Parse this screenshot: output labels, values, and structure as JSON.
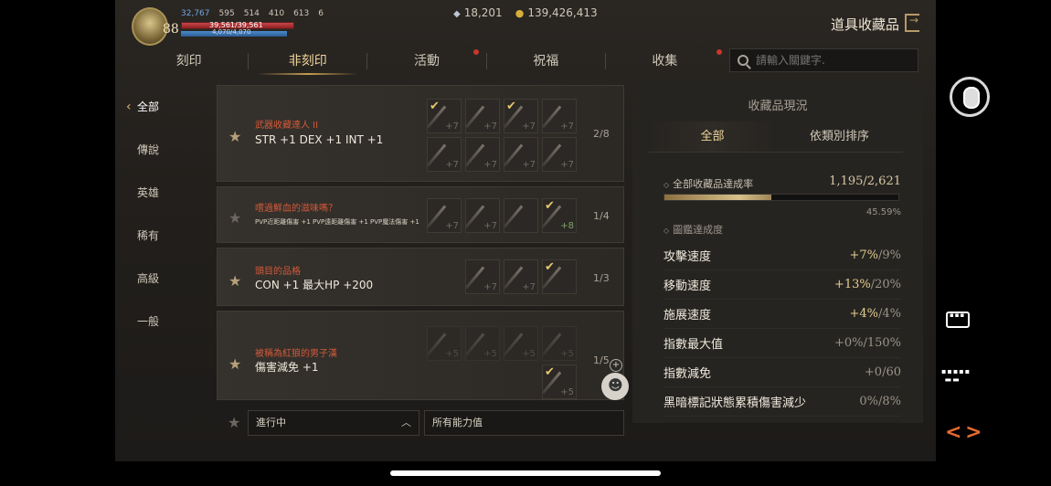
{
  "hud": {
    "level": "88",
    "stats": [
      "32,767",
      "595",
      "514",
      "410",
      "613",
      "6"
    ],
    "hp": "39,561/39,561",
    "mp": "4,070/4,070",
    "gems": "18,201",
    "coins": "139,426,413"
  },
  "page_title": "道具收藏品",
  "tabs": [
    "刻印",
    "非刻印",
    "活動",
    "祝福",
    "收集"
  ],
  "search": {
    "placeholder": "請輸入關鍵字."
  },
  "filters": [
    "全部",
    "傳說",
    "英雄",
    "稀有",
    "高級",
    "一般"
  ],
  "collections": [
    {
      "name": "武器收藏達人 II",
      "effect": "STR +1 DEX +1 INT +1",
      "count": "2/8",
      "slots": [
        "+7",
        "+7",
        "+7",
        "+7",
        "+7",
        "+7",
        "+7",
        "+7"
      ]
    },
    {
      "name": "嚐過鮮血的滋味嗎？",
      "effect": "PVP近距離傷害 +1 PVP遠距離傷害 +1 PVP魔法傷害 +1",
      "count": "1/4",
      "slots": [
        "+7",
        "+7",
        "",
        "+8"
      ]
    },
    {
      "name": "頭目的品格",
      "effect": "CON +1 最大HP +200",
      "count": "1/3",
      "slots": [
        "+7",
        "+7",
        ""
      ]
    },
    {
      "name": "被稱為紅狼的男子漢",
      "effect": "傷害減免 +1",
      "count": "1/5",
      "slots": [
        "+5",
        "+5",
        "+5",
        "+5",
        "+5"
      ]
    }
  ],
  "bottom": {
    "status_filter": "進行中",
    "stat_filter": "所有能力值"
  },
  "panel": {
    "title": "收藏品現況",
    "tabs": [
      "全部",
      "依類別排序"
    ],
    "rate_label": "全部收藏品達成率",
    "rate_value": "1,195/2,621",
    "rate_pct": "45.59%",
    "progress": 0.4559,
    "section_label": "圖鑑達成度",
    "stats": [
      {
        "label": "攻擊速度",
        "cur": "+7%",
        "max": "/9%"
      },
      {
        "label": "移動速度",
        "cur": "+13%",
        "max": "/20%"
      },
      {
        "label": "施展速度",
        "cur": "+4%",
        "max": "/4%"
      },
      {
        "label": "指數最大值",
        "cur": "",
        "max": "+0%/150%"
      },
      {
        "label": "指數減免",
        "cur": "",
        "max": "+0/60"
      },
      {
        "label": "黑暗標記狀態累積傷害減少",
        "cur": "",
        "max": "0%/8%"
      }
    ]
  }
}
